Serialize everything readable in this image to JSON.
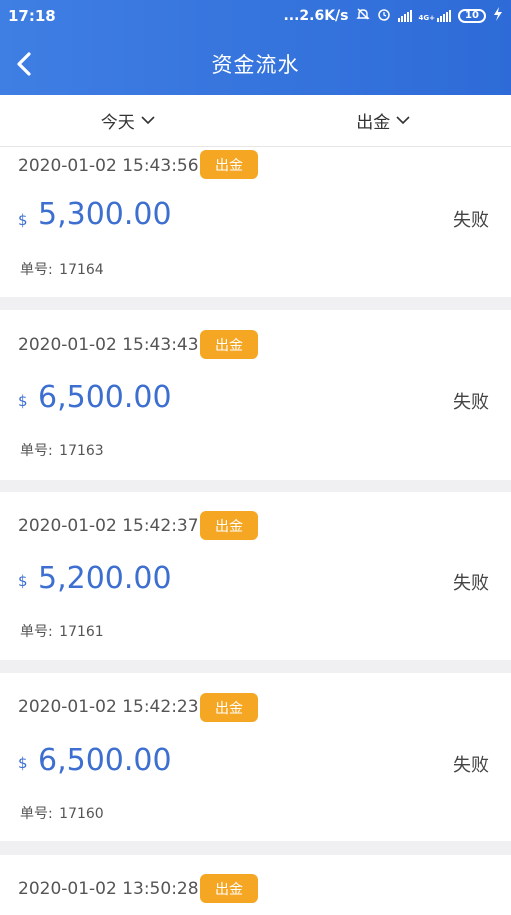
{
  "status_bar": {
    "time": "17:18",
    "net_speed": "...2.6K/s",
    "net_type": "4G+",
    "battery": "10"
  },
  "header": {
    "title": "资金流水"
  },
  "filters": {
    "date_label": "今天",
    "type_label": "出金"
  },
  "records": [
    {
      "datetime": "2020-01-02 15:43:56",
      "badge": "出金",
      "currency": "$",
      "amount": "5,300.00",
      "status": "失败",
      "order_label": "单号:",
      "order_no": "17164"
    },
    {
      "datetime": "2020-01-02 15:43:43",
      "badge": "出金",
      "currency": "$",
      "amount": "6,500.00",
      "status": "失败",
      "order_label": "单号:",
      "order_no": "17163"
    },
    {
      "datetime": "2020-01-02 15:42:37",
      "badge": "出金",
      "currency": "$",
      "amount": "5,200.00",
      "status": "失败",
      "order_label": "单号:",
      "order_no": "17161"
    },
    {
      "datetime": "2020-01-02 15:42:23",
      "badge": "出金",
      "currency": "$",
      "amount": "6,500.00",
      "status": "失败",
      "order_label": "单号:",
      "order_no": "17160"
    },
    {
      "datetime": "2020-01-02 13:50:28",
      "badge": "出金",
      "currency": "",
      "amount": "",
      "status": "",
      "order_label": "",
      "order_no": ""
    }
  ],
  "colors": {
    "header": "#3f7ee3",
    "badge": "#f5a623",
    "amount": "#3d6fd0"
  }
}
